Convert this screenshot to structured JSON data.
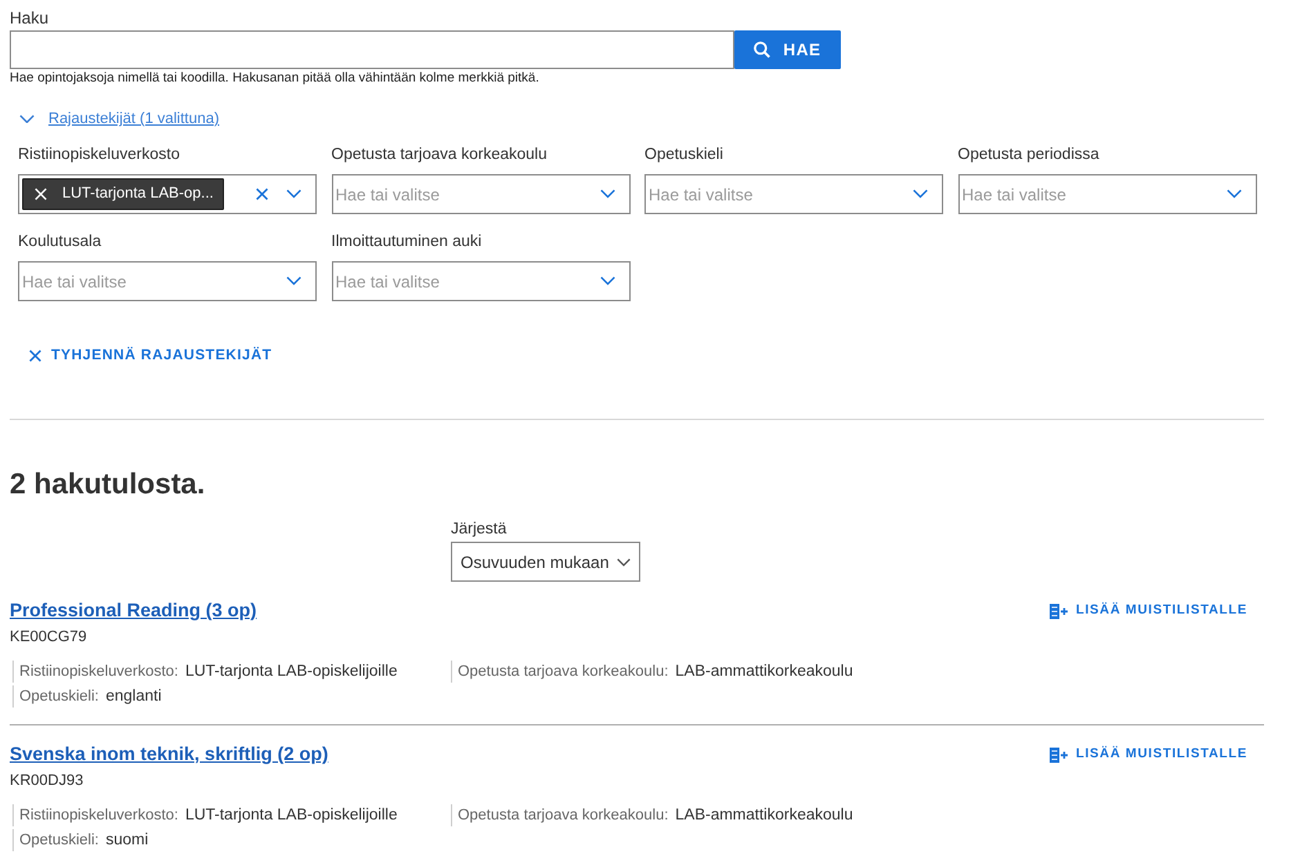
{
  "search": {
    "label": "Haku",
    "button": "HAE",
    "hint": "Hae opintojaksoja nimellä tai koodilla. Hakusanan pitää olla vähintään kolme merkkiä pitkä."
  },
  "filters_toggle": {
    "label": "Rajaustekijät (1 valittuna)",
    "expanded": true
  },
  "filters": [
    {
      "label": "Ristiinopiskeluverkosto",
      "tags": [
        "LUT-tarjonta LAB-op..."
      ]
    },
    {
      "label": "Opetusta tarjoava korkeakoulu",
      "placeholder": "Hae tai valitse"
    },
    {
      "label": "Opetuskieli",
      "placeholder": "Hae tai valitse"
    },
    {
      "label": "Opetusta periodissa",
      "placeholder": "Hae tai valitse"
    },
    {
      "label": "Koulutusala",
      "placeholder": "Hae tai valitse"
    },
    {
      "label": "Ilmoittautuminen auki",
      "placeholder": "Hae tai valitse"
    }
  ],
  "clear_button": "TYHJENNÄ RAJAUSTEKIJÄT",
  "results_heading": "2 hakutulosta.",
  "sort": {
    "label": "Järjestä",
    "value": "Osuvuuden mukaan"
  },
  "results": [
    {
      "title": "Professional Reading (3 op)",
      "code": "KE00CG79",
      "action": "LISÄÄ MUISTILISTALLE",
      "details": [
        {
          "label": "Ristiinopiskeluverkosto:",
          "value": "LUT-tarjonta LAB-opiskelijoille"
        },
        {
          "label": "Opetusta tarjoava korkeakoulu:",
          "value": "LAB-ammattikorkeakoulu"
        },
        {
          "label": "Opetuskieli:",
          "value": "englanti"
        }
      ]
    },
    {
      "title": "Svenska inom teknik, skriftlig (2 op)",
      "code": "KR00DJ93",
      "action": "LISÄÄ MUISTILISTALLE",
      "details": [
        {
          "label": "Ristiinopiskeluverkosto:",
          "value": "LUT-tarjonta LAB-opiskelijoille"
        },
        {
          "label": "Opetusta tarjoava korkeakoulu:",
          "value": "LAB-ammattikorkeakoulu"
        },
        {
          "label": "Opetuskieli:",
          "value": "suomi"
        }
      ]
    }
  ]
}
